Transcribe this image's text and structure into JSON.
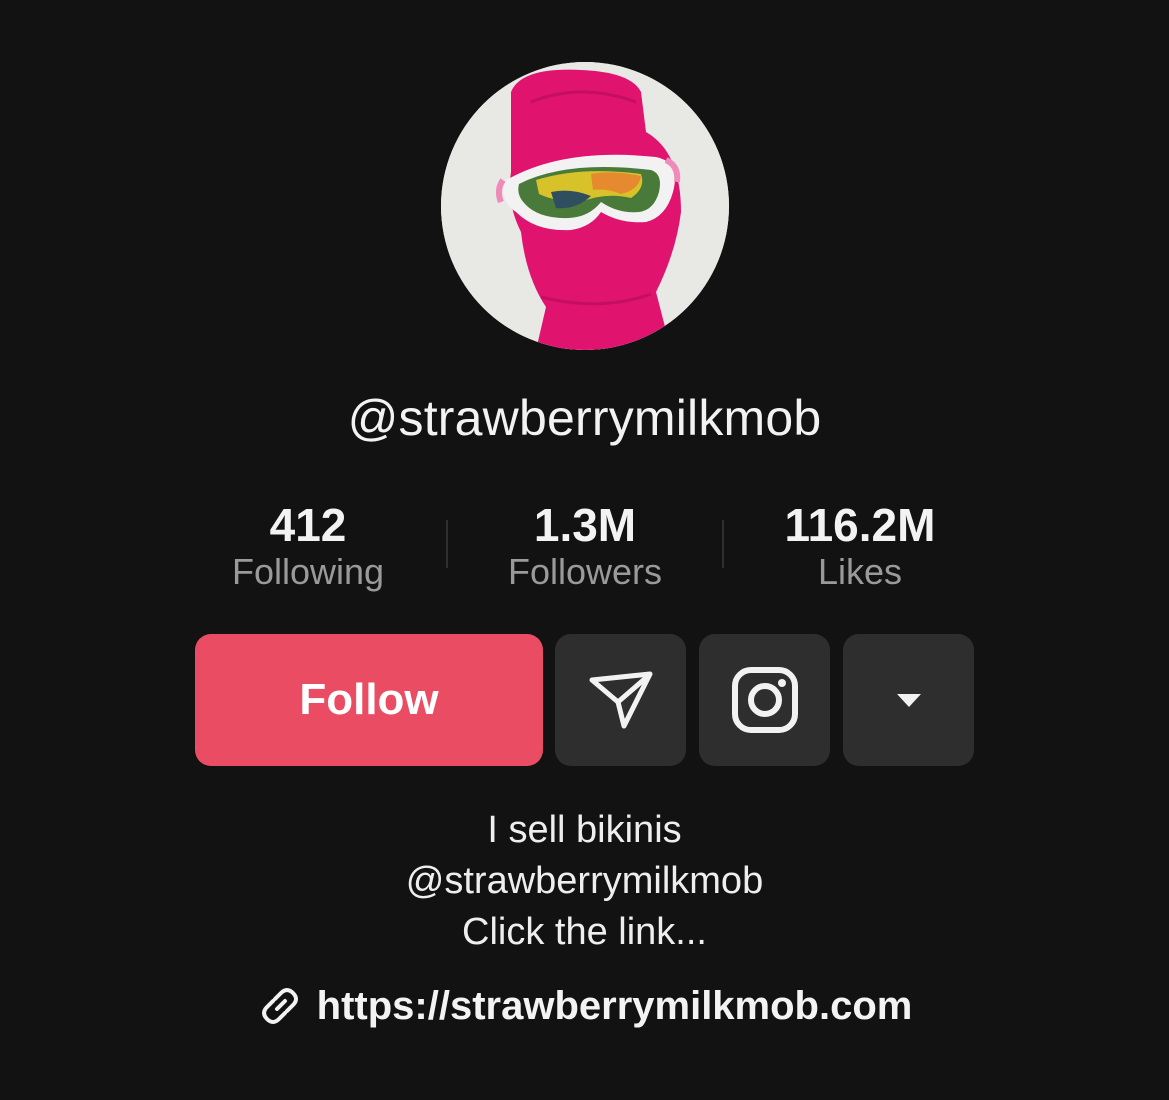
{
  "profile": {
    "username": "@strawberrymilkmob",
    "avatar_alt": ""
  },
  "stats": [
    {
      "value": "412",
      "label": "Following"
    },
    {
      "value": "1.3M",
      "label": "Followers"
    },
    {
      "value": "116.2M",
      "label": "Likes"
    }
  ],
  "actions": {
    "follow_label": "Follow",
    "message_icon": "send-icon",
    "instagram_icon": "instagram-icon",
    "more_icon": "caret-down-icon"
  },
  "bio": {
    "line1": "I sell bikinis",
    "line2": "@strawberrymilkmob",
    "line3": "Click the link..."
  },
  "link": {
    "icon": "link-icon",
    "url": "https://strawberrymilkmob.com"
  },
  "colors": {
    "background": "#121212",
    "follow_button": "#ea4d63",
    "icon_button": "#2e2e2e",
    "muted_text": "#9a9a9a",
    "avatar_balaclava": "#e0136f"
  }
}
